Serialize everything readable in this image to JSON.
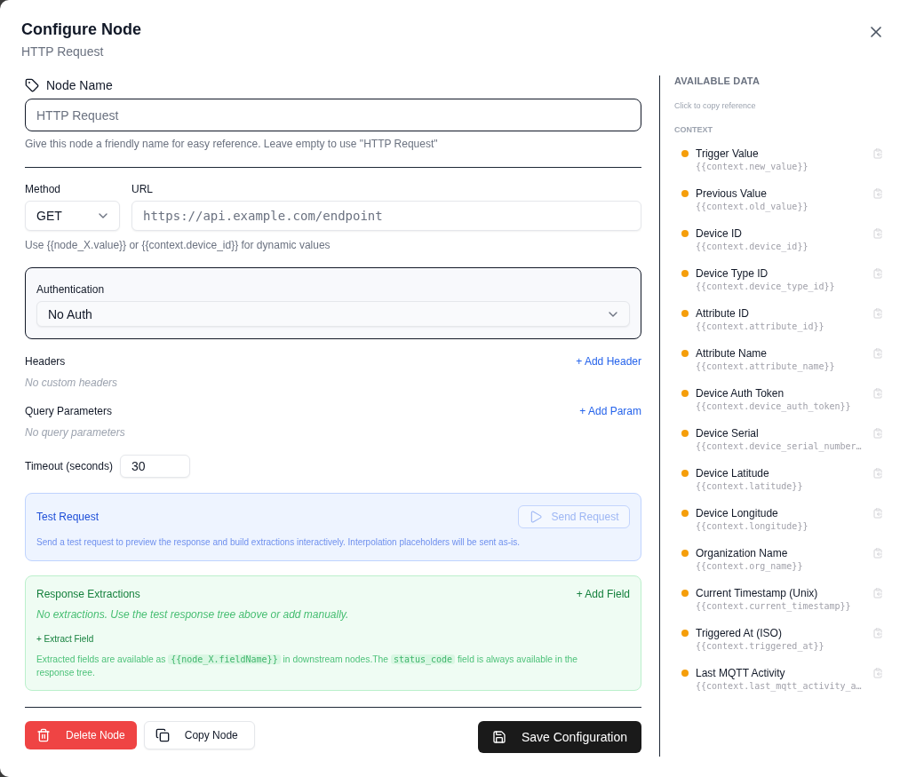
{
  "dialog": {
    "title": "Configure Node",
    "subtitle": "HTTP Request"
  },
  "node_name": {
    "label": "Node Name",
    "placeholder": "HTTP Request",
    "hint": "Give this node a friendly name for easy reference. Leave empty to use \"HTTP Request\""
  },
  "request": {
    "method": {
      "label": "Method",
      "value": "GET"
    },
    "url": {
      "label": "URL",
      "placeholder": "https://api.example.com/endpoint"
    },
    "hint": "Use {{node_X.value}} or {{context.device_id}} for dynamic values"
  },
  "authentication": {
    "label": "Authentication",
    "value": "No Auth"
  },
  "lists": [
    {
      "label": "Headers",
      "action": "+ Add Header",
      "empty": "No custom headers"
    },
    {
      "label": "Query Parameters",
      "action": "+ Add Param",
      "empty": "No query parameters"
    }
  ],
  "timeout": {
    "label": "Timeout (seconds)",
    "value": "30"
  },
  "test_request": {
    "title": "Test Request",
    "button": {
      "label": "Send Request",
      "disabled": true
    },
    "description": "Send a test request to preview the response and build extractions interactively. Interpolation placeholders will be sent as-is."
  },
  "response_extractions": {
    "title": "Response Extractions",
    "action": "+ Add Field",
    "empty": "No extractions. Use the test response tree above or add manually.",
    "extract": "+ Extract Field",
    "note": [
      {
        "kind": "text",
        "text": "Extracted fields are available as "
      },
      {
        "kind": "code",
        "text": "{{node_X.fieldName}}"
      },
      {
        "kind": "text",
        "text": " in downstream nodes.The "
      },
      {
        "kind": "code",
        "text": "status_code"
      },
      {
        "kind": "text",
        "text": " field is always available in the response tree."
      }
    ]
  },
  "actions": [
    {
      "kind": "delete",
      "label": "Delete Node"
    },
    {
      "kind": "copy",
      "label": "Copy Node"
    },
    {
      "kind": "save",
      "label": "Save Configuration"
    }
  ],
  "available_data": {
    "title": "AVAILABLE DATA",
    "hint": "Click to copy reference",
    "section": "CONTEXT",
    "items": [
      {
        "label": "Trigger Value",
        "reference": "{{context.new_value}}"
      },
      {
        "label": "Previous Value",
        "reference": "{{context.old_value}}"
      },
      {
        "label": "Device ID",
        "reference": "{{context.device_id}}"
      },
      {
        "label": "Device Type ID",
        "reference": "{{context.device_type_id}}"
      },
      {
        "label": "Attribute ID",
        "reference": "{{context.attribute_id}}"
      },
      {
        "label": "Attribute Name",
        "reference": "{{context.attribute_name}}"
      },
      {
        "label": "Device Auth Token",
        "reference": "{{context.device_auth_token}}"
      },
      {
        "label": "Device Serial",
        "reference": "{{context.device_serial_number…"
      },
      {
        "label": "Device Latitude",
        "reference": "{{context.latitude}}"
      },
      {
        "label": "Device Longitude",
        "reference": "{{context.longitude}}"
      },
      {
        "label": "Organization Name",
        "reference": "{{context.org_name}}"
      },
      {
        "label": "Current Timestamp (Unix)",
        "reference": "{{context.current_timestamp}}"
      },
      {
        "label": "Triggered At (ISO)",
        "reference": "{{context.triggered_at}}"
      },
      {
        "label": "Last MQTT Activity",
        "reference": "{{context.last_mqtt_activity_a…"
      }
    ]
  }
}
